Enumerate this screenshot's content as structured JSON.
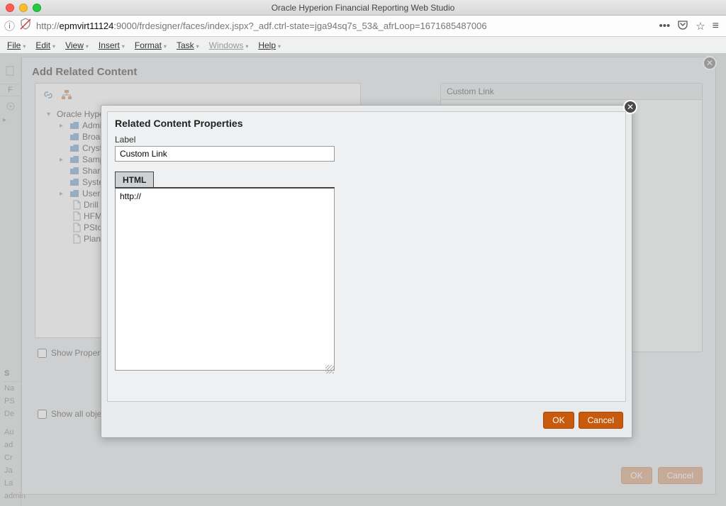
{
  "window": {
    "title": "Oracle Hyperion Financial Reporting Web Studio"
  },
  "url": {
    "prefix": "http://",
    "host": "epmvirt11124",
    "rest": ":9000/frdesigner/faces/index.jspx?_adf.ctrl-state=jga94sq7s_53&_afrLoop=1671685487006"
  },
  "menu": {
    "file": "File",
    "edit": "Edit",
    "view": "View",
    "insert": "Insert",
    "format": "Format",
    "task": "Task",
    "windows": "Windows",
    "help": "Help"
  },
  "left": {
    "f": "F",
    "s": "S",
    "na": "Na",
    "ps": "PS",
    "de": "De",
    "au": "Au",
    "ad": "ad",
    "cr": "Cr",
    "ja": "Ja",
    "la": "La",
    "admin": "admin"
  },
  "modal1": {
    "title": "Add Related Content",
    "custom_link": "Custom Link",
    "show_properties": "Show Propert",
    "show_all": "Show all obje",
    "ok": "OK",
    "cancel": "Cancel",
    "tree": {
      "root": "Oracle Hype",
      "children": [
        "Admin",
        "Broade",
        "Crysta",
        "Sampl",
        "Sharec",
        "Syster",
        "Users"
      ],
      "docs": [
        "Drill Te",
        "HFMR",
        "PStore",
        "PlanRe"
      ]
    }
  },
  "modal2": {
    "title": "Related Content Properties",
    "label_caption": "Label",
    "label_value": "Custom Link",
    "tab": "HTML",
    "html_value": "http://",
    "ok": "OK",
    "cancel": "Cancel"
  }
}
